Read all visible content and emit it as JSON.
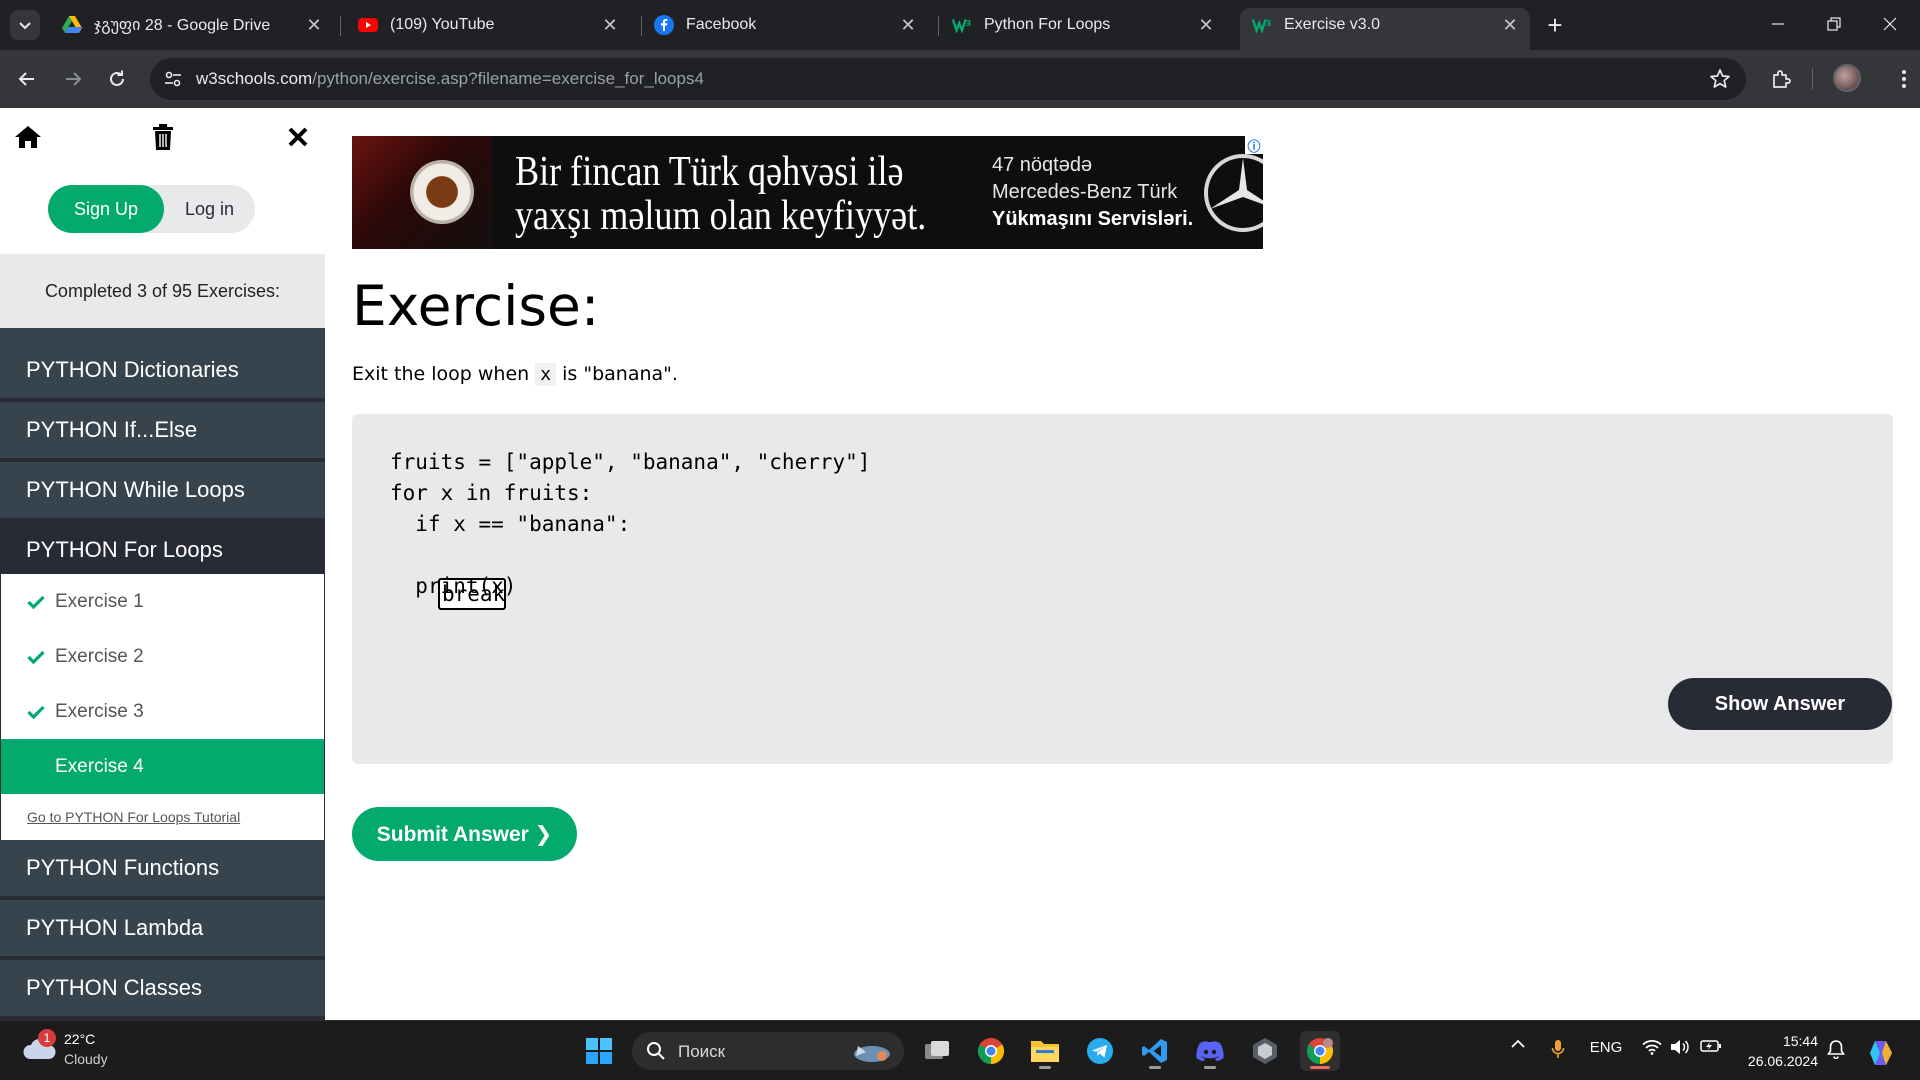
{
  "browser": {
    "tabs": [
      {
        "title": "ჯგუფი 28 - Google Drive",
        "icon": "google-drive-icon"
      },
      {
        "title": "(109) YouTube",
        "icon": "youtube-icon"
      },
      {
        "title": "Facebook",
        "icon": "facebook-icon"
      },
      {
        "title": "Python For Loops",
        "icon": "w3schools-icon"
      },
      {
        "title": "Exercise v3.0",
        "icon": "w3schools-icon",
        "active": true
      }
    ],
    "url_host": "w3schools.com",
    "url_path": "/python/exercise.asp?filename=exercise_for_loops4"
  },
  "sidebar": {
    "signup_label": "Sign Up",
    "login_label": "Log in",
    "progress_text": "Completed 3 of 95 Exercises:",
    "sections_before": [
      {
        "label": "PYTHON Dictionaries"
      },
      {
        "label": "PYTHON If...Else"
      },
      {
        "label": "PYTHON While Loops"
      }
    ],
    "open_section": "PYTHON For Loops",
    "exercises": [
      {
        "label": "Exercise 1",
        "done": true
      },
      {
        "label": "Exercise 2",
        "done": true
      },
      {
        "label": "Exercise 3",
        "done": true
      },
      {
        "label": "Exercise 4",
        "done": false,
        "active": true
      }
    ],
    "tutorial_link": "Go to PYTHON For Loops Tutorial",
    "sections_after": [
      {
        "label": "PYTHON Functions"
      },
      {
        "label": "PYTHON Lambda"
      },
      {
        "label": "PYTHON Classes"
      }
    ]
  },
  "ad": {
    "headline_line1": "Bir fincan Türk qəhvəsi ilə",
    "headline_line2": "yaxşı məlum olan keyfiyyət.",
    "side_line1": "47 nöqtədə",
    "side_line2": "Mercedes-Benz Türk",
    "side_line3": "Yükmaşını Servisləri."
  },
  "exercise": {
    "title": "Exercise:",
    "instruction_before": "Exit the loop when",
    "instruction_code": "x",
    "instruction_after": "is \"banana\".",
    "code_lines": [
      "fruits = [\"apple\", \"banana\", \"cherry\"]",
      "for x in fruits:",
      "  if x == \"banana\":",
      "",
      "  print(x)"
    ],
    "answer_value": "break",
    "show_answer_label": "Show Answer",
    "submit_label": "Submit Answer ❯"
  },
  "taskbar": {
    "weather_temp": "22°C",
    "weather_condition": "Cloudy",
    "weather_badge": "1",
    "search_label": "Поиск",
    "language": "ENG",
    "time": "15:44",
    "date": "26.06.2024"
  },
  "colors": {
    "w3_green": "#04aa6d",
    "sidebar_dark": "#282a35",
    "sidebar_item": "#38444d",
    "code_panel": "#e7e9eb"
  }
}
